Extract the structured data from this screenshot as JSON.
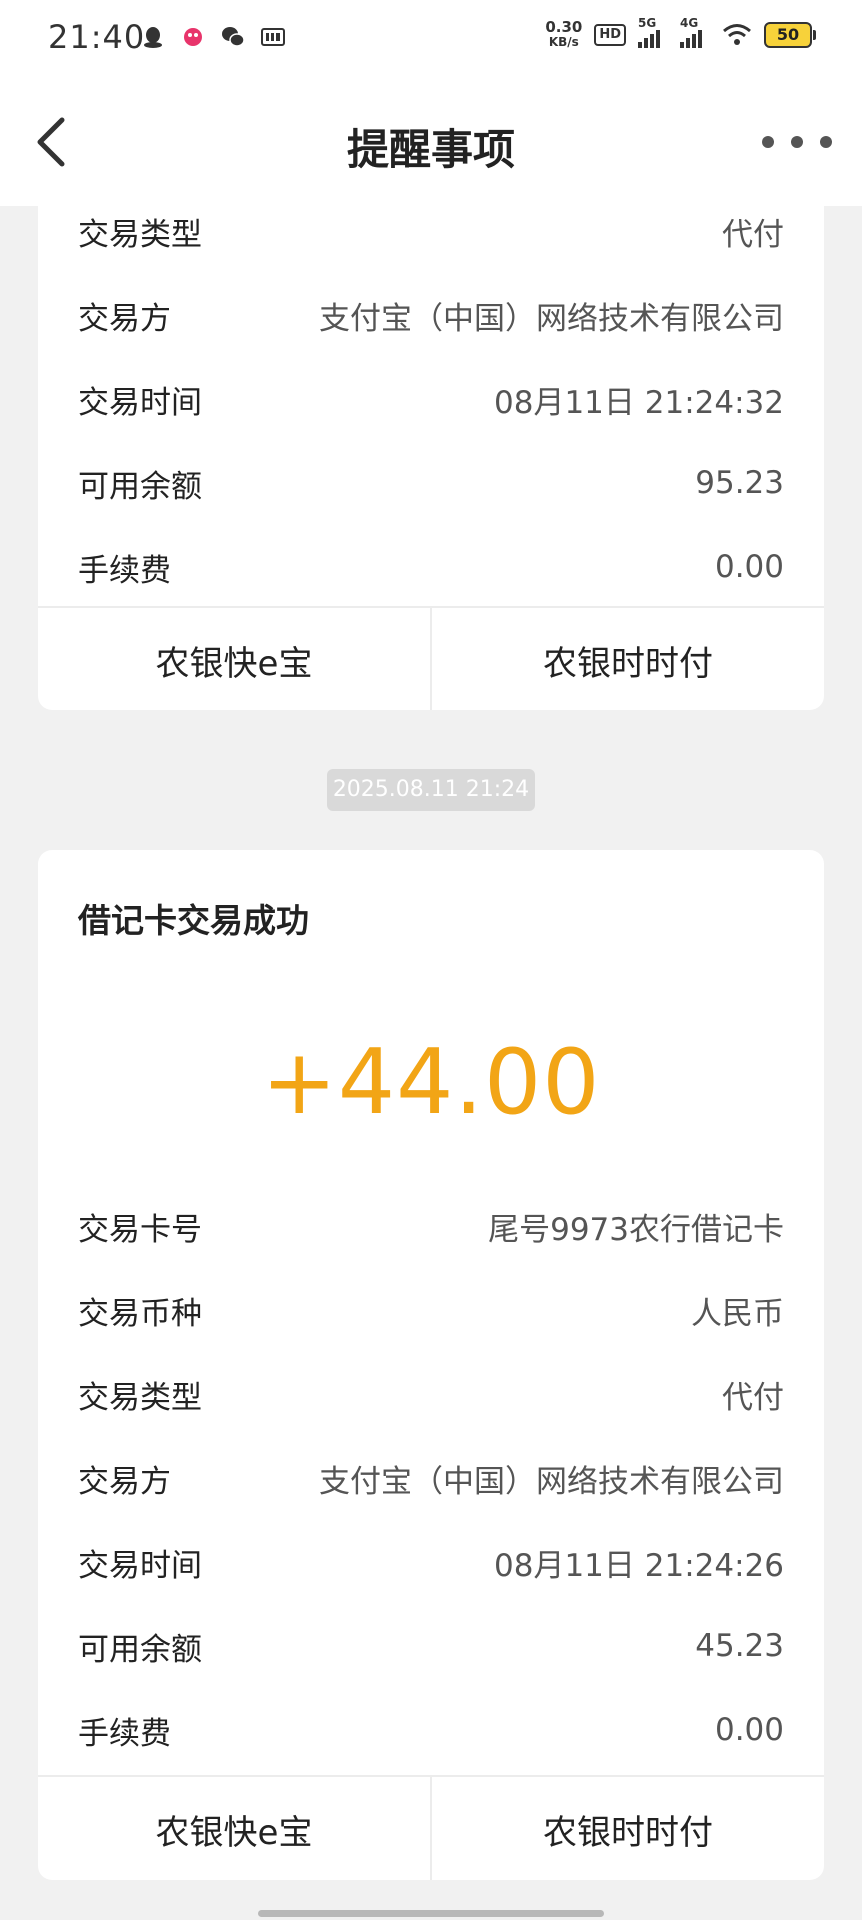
{
  "status_bar": {
    "time": "21:40",
    "net_speed_value": "0.30",
    "net_speed_unit": "KB/s",
    "hd_label": "HD",
    "signal_1_label": "5G",
    "signal_2_label": "4G",
    "battery_level": "50",
    "icons": [
      "qq-icon",
      "app-icon",
      "wechat-icon",
      "iqiyi-icon"
    ]
  },
  "header": {
    "title": "提醒事项"
  },
  "top_card": {
    "rows": [
      {
        "label": "交易类型",
        "value": "代付"
      },
      {
        "label": "交易方",
        "value": "支付宝（中国）网络技术有限公司"
      },
      {
        "label": "交易时间",
        "value": "08月11日 21:24:32"
      },
      {
        "label": "可用余额",
        "value": "95.23"
      },
      {
        "label": "手续费",
        "value": "0.00"
      }
    ],
    "buttons": {
      "left": "农银快e宝",
      "right": "农银时时付"
    }
  },
  "timestamp_chip": "2025.08.11 21:24",
  "bottom_card": {
    "heading": "借记卡交易成功",
    "amount": "+44.00",
    "rows": [
      {
        "label": "交易卡号",
        "value": "尾号9973农行借记卡"
      },
      {
        "label": "交易币种",
        "value": "人民币"
      },
      {
        "label": "交易类型",
        "value": "代付"
      },
      {
        "label": "交易方",
        "value": "支付宝（中国）网络技术有限公司"
      },
      {
        "label": "交易时间",
        "value": "08月11日 21:24:26"
      },
      {
        "label": "可用余额",
        "value": "45.23"
      },
      {
        "label": "手续费",
        "value": "0.00"
      }
    ],
    "buttons": {
      "left": "农银快e宝",
      "right": "农银时时付"
    }
  },
  "colors": {
    "amount": "#f2a516",
    "background": "#f1f1f1",
    "card": "#ffffff",
    "battery": "#f7d23a"
  }
}
